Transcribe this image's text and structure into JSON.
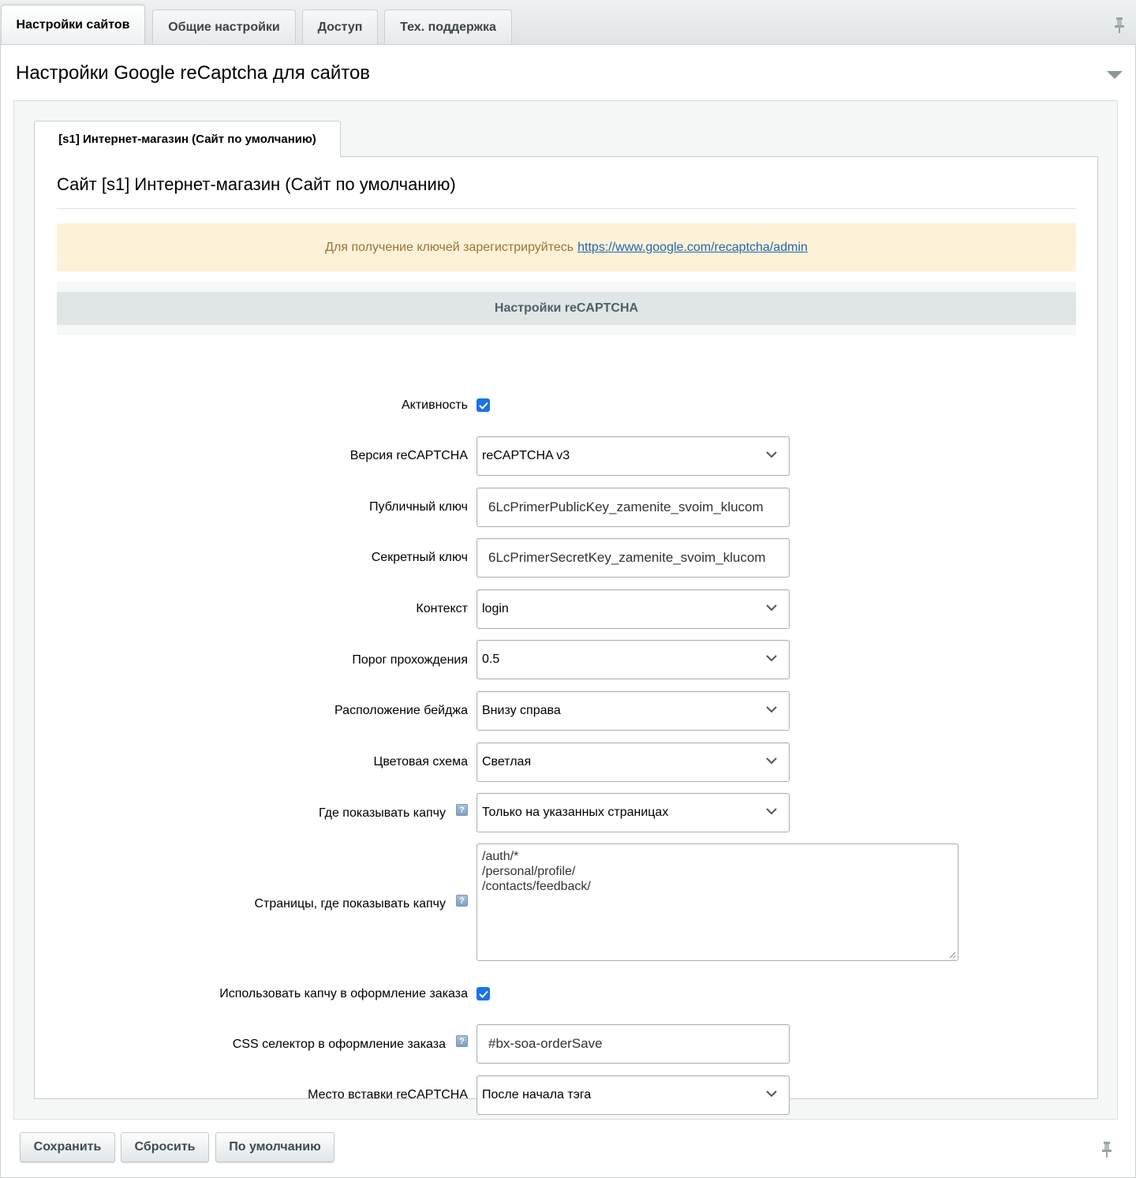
{
  "top_tabs": [
    {
      "label": "Настройки сайтов",
      "active": true
    },
    {
      "label": "Общие настройки",
      "active": false
    },
    {
      "label": "Доступ",
      "active": false
    },
    {
      "label": "Тех. поддержка",
      "active": false
    }
  ],
  "section": {
    "title": "Настройки Google reCaptcha для сайтов"
  },
  "site_tab": {
    "label": "[s1] Интернет-магазин (Сайт по умолчанию)"
  },
  "site": {
    "title": "Сайт [s1] Интернет-магазин (Сайт по умолчанию)"
  },
  "notice": {
    "text": "Для получение ключей зарегистрируйтесь",
    "link": "https://www.google.com/recaptcha/admin"
  },
  "heading": "Настройки reCAPTCHA",
  "form": {
    "active": {
      "label": "Активность",
      "checked": true
    },
    "version": {
      "label": "Версия reCAPTCHA",
      "value": "reCAPTCHA v3"
    },
    "public_key": {
      "label": "Публичный ключ",
      "value": "6LcPrimerPublicKey_zamenite_svoim_klucom"
    },
    "secret_key": {
      "label": "Секретный ключ",
      "value": "6LcPrimerSecretKey_zamenite_svoim_klucom"
    },
    "context": {
      "label": "Контекст",
      "value": "login"
    },
    "threshold": {
      "label": "Порог прохождения",
      "value": "0.5"
    },
    "badge": {
      "label": "Расположение бейджа",
      "value": "Внизу справа"
    },
    "theme": {
      "label": "Цветовая схема",
      "value": "Светлая"
    },
    "where": {
      "label": "Где показывать капчу",
      "value": "Только на указанных страницах"
    },
    "pages": {
      "label": "Страницы, где показывать капчу",
      "lines": [
        "/auth/*",
        "/personal/profile/",
        "/contacts/feedback/"
      ]
    },
    "order": {
      "label": "Использовать капчу в оформление заказа",
      "checked": true
    },
    "css_selector": {
      "label": "CSS селектор в оформление заказа",
      "value": "#bx-soa-orderSave"
    },
    "insert": {
      "label": "Место вставки reCAPTCHA",
      "value": "После начала тэга"
    }
  },
  "buttons": {
    "save": "Сохранить",
    "reset": "Сбросить",
    "default": "По умолчанию"
  },
  "icons": {
    "pin": "pin-icon",
    "collapse": "triangle-down-icon",
    "help": "question-icon",
    "check": "check-icon",
    "chevron": "chevron-down-icon"
  },
  "colors": {
    "checkbox": "#1a73e8",
    "notice_bg": "#fdf1d8",
    "link": "#2067b0",
    "heading_bg": "#e0e5e6"
  }
}
